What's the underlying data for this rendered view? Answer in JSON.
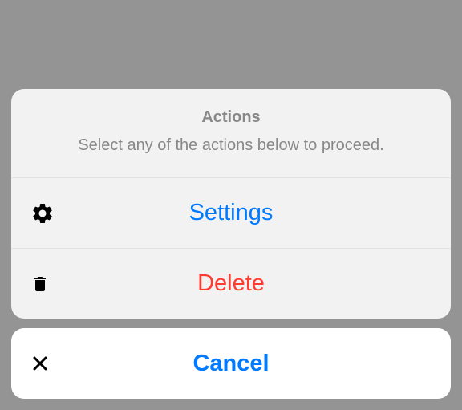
{
  "sheet": {
    "title": "Actions",
    "message": "Select any of the actions below to proceed.",
    "actions": {
      "settings": {
        "label": "Settings"
      },
      "delete": {
        "label": "Delete"
      }
    },
    "cancel": {
      "label": "Cancel"
    }
  }
}
